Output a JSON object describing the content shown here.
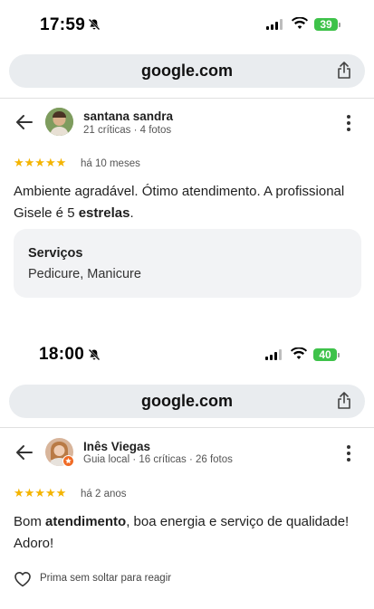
{
  "screens": [
    {
      "status_time": "17:59",
      "battery": "39",
      "url": "google.com",
      "reviewer_name": "santana sandra",
      "reviewer_meta": "21 críticas · 4 fotos",
      "stars": "★★★★★",
      "when": "há 10 meses",
      "review_parts": [
        "Ambiente agradável. Ótimo atendimento. A profissional Gisele é 5 ",
        "estrelas",
        "."
      ],
      "services_title": "Serviços",
      "services_value": "Pedicure, Manicure"
    },
    {
      "status_time": "18:00",
      "battery": "40",
      "url": "google.com",
      "reviewer_name": "Inês Viegas",
      "reviewer_meta": "Guia local · 16 críticas · 26 fotos",
      "stars": "★★★★★",
      "when": "há 2 anos",
      "review_parts": [
        "Bom ",
        "atendimento",
        ", boa energia e serviço de qualidade! Adoro!"
      ],
      "react_label": "Prima sem soltar para reagir"
    }
  ],
  "colors": {
    "star": "#f4b400",
    "battery": "#3ec24a",
    "urlbar": "#e9ecef"
  }
}
